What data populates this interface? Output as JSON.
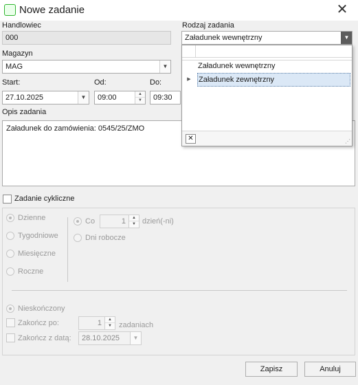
{
  "window": {
    "title": "Nowe zadanie",
    "close_glyph": "✕",
    "icon": "app-icon"
  },
  "form": {
    "salesperson_label": "Handlowiec",
    "salesperson_value": "000",
    "task_type_label": "Rodzaj zadania",
    "task_type_value": "Załadunek wewnętrzny",
    "warehouse_label": "Magazyn",
    "warehouse_value": "MAG",
    "start_label": "Start:",
    "start_value": "27.10.2025",
    "from_label": "Od:",
    "from_value": "09:00",
    "to_label": "Do:",
    "to_value": "09:30",
    "description_label": "Opis zadania",
    "description_value": "Załadunek do zamówienia: 0545/25/ZMO"
  },
  "dropdown": {
    "options": [
      {
        "label": "Załadunek wewnętrzny",
        "selected": false
      },
      {
        "label": "Załadunek zewnętrzny",
        "selected": true
      }
    ],
    "clear_glyph": "✕"
  },
  "cyclic": {
    "checkbox_label": "Zadanie cykliczne",
    "checked": false,
    "frequency": [
      "Dzienne",
      "Tygodniowe",
      "Miesięczne",
      "Roczne"
    ],
    "every_label": "Co",
    "every_value": "1",
    "every_unit": "dzień(-ni)",
    "workdays_label": "Dni robocze",
    "end": {
      "infinite_label": "Nieskończony",
      "after_label": "Zakończ po:",
      "after_value": "1",
      "after_unit": "zadaniach",
      "on_date_label": "Zakończ z datą:",
      "on_date_value": "28.10.2025"
    }
  },
  "buttons": {
    "save": "Zapisz",
    "cancel": "Anuluj"
  }
}
